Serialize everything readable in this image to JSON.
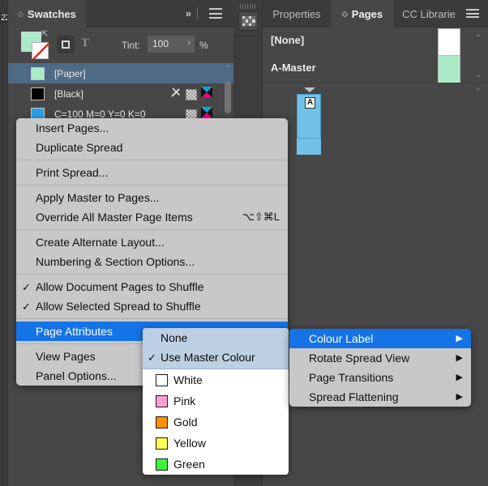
{
  "ruler": {
    "label": "22"
  },
  "swatches_panel": {
    "tab": {
      "diamond": "◇",
      "label": "Swatches"
    },
    "chevrons": "»",
    "hamburger_icon": "hamburger-icon",
    "toolbar": {
      "fill_color": "#aaeac7",
      "stroke_none": true,
      "formatting_affects_container": "formatting-container-icon",
      "formatting_affects_text": "T",
      "tint_label": "Tint:",
      "tint_value": "100",
      "tint_stepper": "›",
      "tint_percent": "%"
    },
    "rows": [
      {
        "name": "[Paper]",
        "color": "#aaeac7",
        "selected": true,
        "icons": []
      },
      {
        "name": "[Black]",
        "color": "#000000",
        "selected": false,
        "icons": [
          "pen-icon",
          "tile-icon",
          "cmyk-icon"
        ]
      },
      {
        "name": "C=100 M=0 Y=0 K=0",
        "color": "#2ba0e8",
        "selected": false,
        "icons": [
          "tile-icon",
          "cmyk-icon"
        ]
      }
    ]
  },
  "dock": {
    "icon_column": {
      "pages_icon": "pages-grid-icon"
    },
    "tabs": [
      {
        "label": "Properties",
        "active": false
      },
      {
        "label": "Pages",
        "active": true,
        "diamond": "◇"
      },
      {
        "label": "CC Librarie",
        "active": false
      }
    ],
    "hamburger_icon": "hamburger-icon",
    "masters": [
      {
        "name": "[None]",
        "thumb_color": "#ffffff"
      },
      {
        "name": "A-Master",
        "thumb_color": "#aaeac7"
      }
    ],
    "pages": [
      {
        "master_badge": "A",
        "thumb_color": "#72c2e8"
      }
    ],
    "scroll_arrow_up": "⌃",
    "scroll_arrow_down": "⌄"
  },
  "page_menu": {
    "items": [
      {
        "label": "Insert Pages...",
        "type": "item"
      },
      {
        "label": "Duplicate Spread",
        "type": "item"
      },
      {
        "type": "separator"
      },
      {
        "label": "Print Spread...",
        "type": "item"
      },
      {
        "type": "separator"
      },
      {
        "label": "Apply Master to Pages...",
        "type": "item"
      },
      {
        "label": "Override All Master Page Items",
        "type": "item",
        "shortcut": "⌥⇧⌘L"
      },
      {
        "type": "separator"
      },
      {
        "label": "Create Alternate Layout...",
        "type": "item"
      },
      {
        "label": "Numbering & Section Options...",
        "type": "item"
      },
      {
        "type": "separator"
      },
      {
        "label": "Allow Document Pages to Shuffle",
        "type": "item",
        "checked": true
      },
      {
        "label": "Allow Selected Spread to Shuffle",
        "type": "item",
        "checked": true
      },
      {
        "type": "separator"
      },
      {
        "label": "Page Attributes",
        "type": "item",
        "highlight": true
      },
      {
        "type": "separator"
      },
      {
        "label": "View Pages",
        "type": "item"
      },
      {
        "label": "Panel Options...",
        "type": "item"
      }
    ]
  },
  "attributes_submenu": {
    "top_items": [
      {
        "label": "None",
        "checked": false
      },
      {
        "label": "Use Master Colour",
        "checked": true
      }
    ],
    "colors": [
      {
        "label": "White",
        "swatch": "#ffffff"
      },
      {
        "label": "Pink",
        "swatch": "#f79fd4"
      },
      {
        "label": "Gold",
        "swatch": "#fd9200"
      },
      {
        "label": "Yellow",
        "swatch": "#fdfd54"
      },
      {
        "label": "Green",
        "swatch": "#3cf43c"
      }
    ]
  },
  "label_submenu": {
    "items": [
      {
        "label": "Colour Label",
        "arrow": "▶",
        "highlight": true
      },
      {
        "label": "Rotate Spread View",
        "arrow": "▶",
        "highlight": false
      },
      {
        "label": "Page Transitions",
        "arrow": "▶",
        "highlight": false
      },
      {
        "label": "Spread Flattening",
        "arrow": "▶",
        "highlight": false
      }
    ]
  },
  "colors": {
    "accent_blue": "#1473e6",
    "panel_bg": "#474747",
    "menu_bg": "#c8c8c8",
    "submenu_blue": "#bccfe3"
  }
}
